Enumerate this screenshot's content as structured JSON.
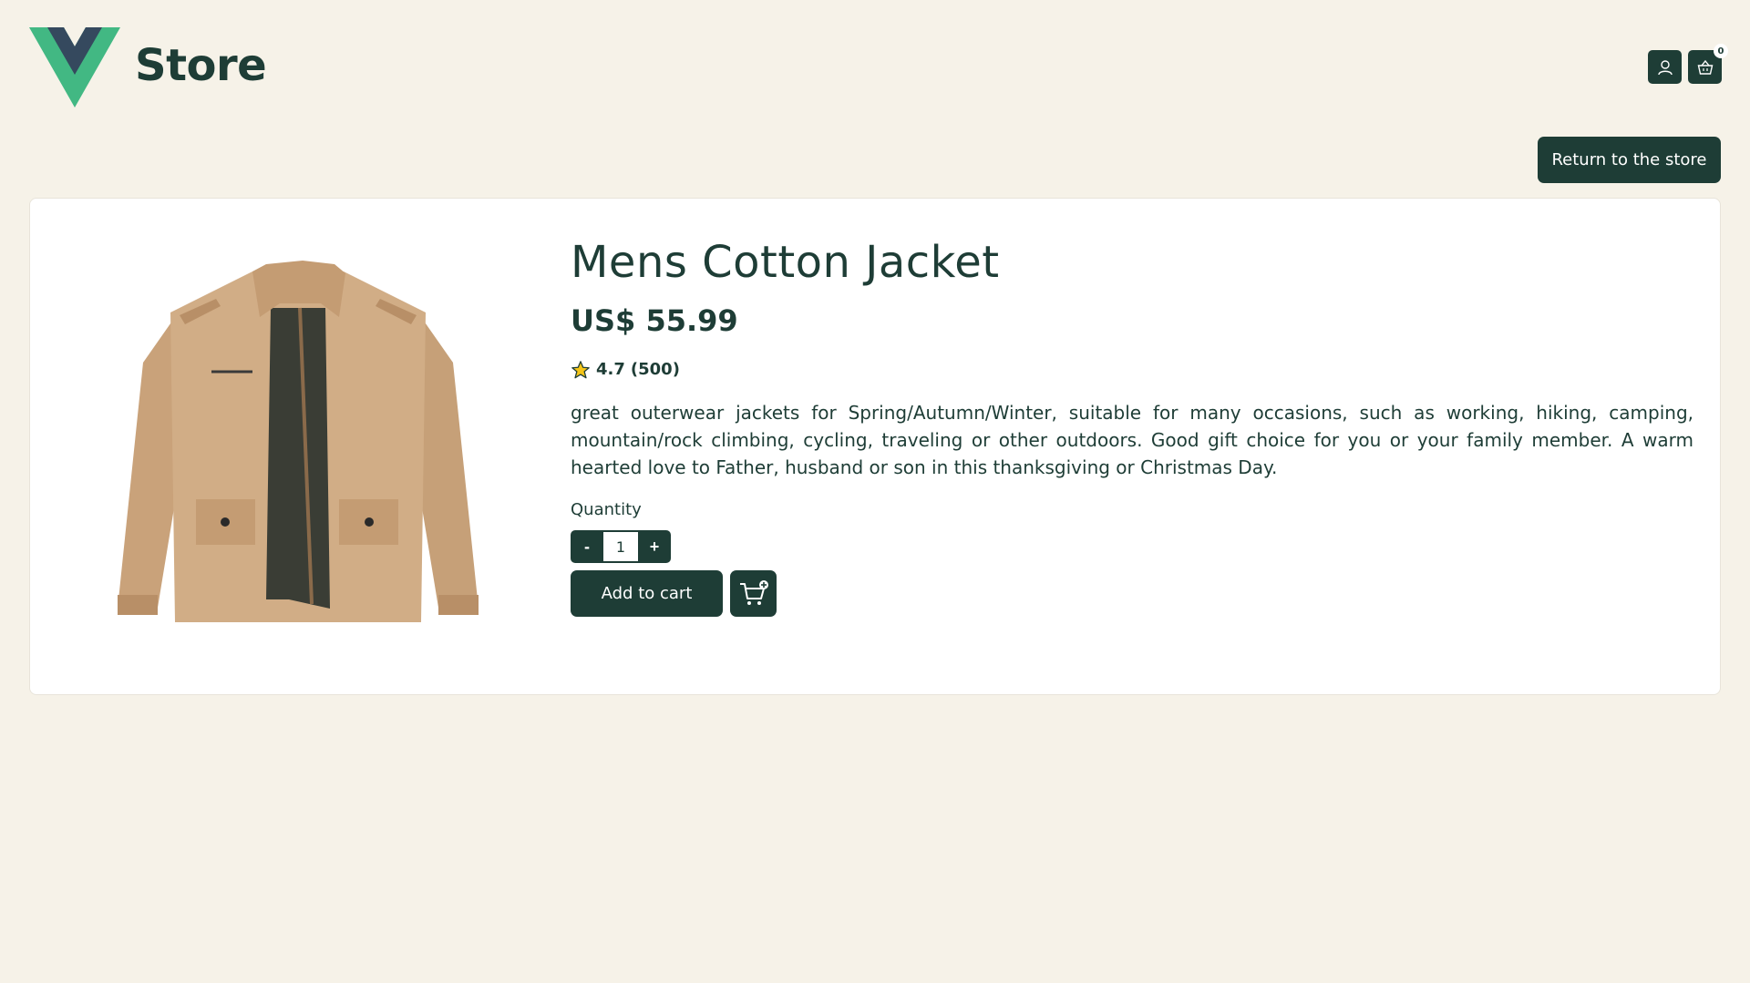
{
  "header": {
    "brand": "Store",
    "cart_count": "0",
    "user_icon": "user-icon",
    "basket_icon": "basket-icon"
  },
  "navigation": {
    "return_label": "Return to the store"
  },
  "product": {
    "title": "Mens Cotton Jacket",
    "price": "US$ 55.99",
    "rating": "4.7",
    "rating_count": "(500)",
    "description": "great outerwear jackets for Spring/Autumn/Winter, suitable for many occasions, such as working, hiking, camping, mountain/rock climbing, cycling, traveling or other outdoors. Good gift choice for you or your family member. A warm hearted love to Father, husband or son in this thanksgiving or Christmas Day.",
    "image_icon": "jacket-image"
  },
  "purchase": {
    "quantity_label": "Quantity",
    "decrement_label": "-",
    "increment_label": "+",
    "quantity_value": "1",
    "add_to_cart_label": "Add to cart",
    "add_cart_icon": "cart-plus-icon"
  },
  "colors": {
    "primary": "#1e3d36",
    "background": "#f6f2e8",
    "card": "#ffffff",
    "logo_green": "#42b883",
    "logo_dark": "#35495e",
    "star": "#f5c518"
  }
}
